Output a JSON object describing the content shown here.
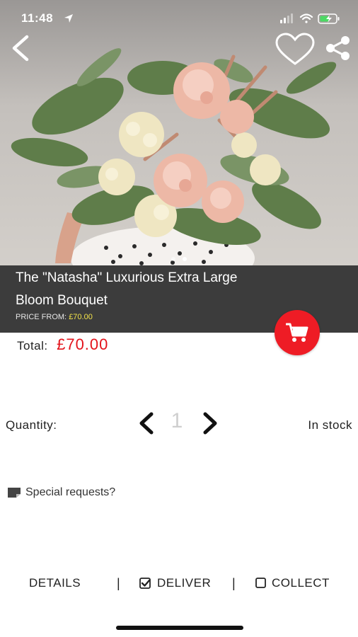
{
  "status_bar": {
    "time": "11:48"
  },
  "product": {
    "title": "The \"Natasha\" Luxurious Extra Large Bloom Bouquet",
    "price_from_label": "PRICE FROM:",
    "price_from_value": "£70.00"
  },
  "total": {
    "label": "Total:",
    "value": "£70.00"
  },
  "quantity": {
    "label": "Quantity:",
    "value": "1",
    "stock_status": "In stock"
  },
  "special_requests": {
    "label": "Special requests?"
  },
  "tabs": {
    "details": "DETAILS",
    "separator": "|",
    "deliver": "DELIVER",
    "collect": "COLLECT"
  },
  "gallery": {
    "slide_count": 2,
    "active_slide": 1
  },
  "colors": {
    "accent_red": "#ee1c25",
    "title_band": "#3c3c3c",
    "price_highlight": "#f3e34a",
    "total_red": "#e3131b"
  },
  "icons": [
    "back-arrow-icon",
    "heart-icon",
    "share-icon",
    "cart-icon",
    "chevron-left-icon",
    "chevron-right-icon",
    "note-icon",
    "checkbox-checked-icon",
    "checkbox-empty-icon",
    "location-arrow-icon",
    "signal-icon",
    "wifi-icon",
    "battery-icon"
  ]
}
